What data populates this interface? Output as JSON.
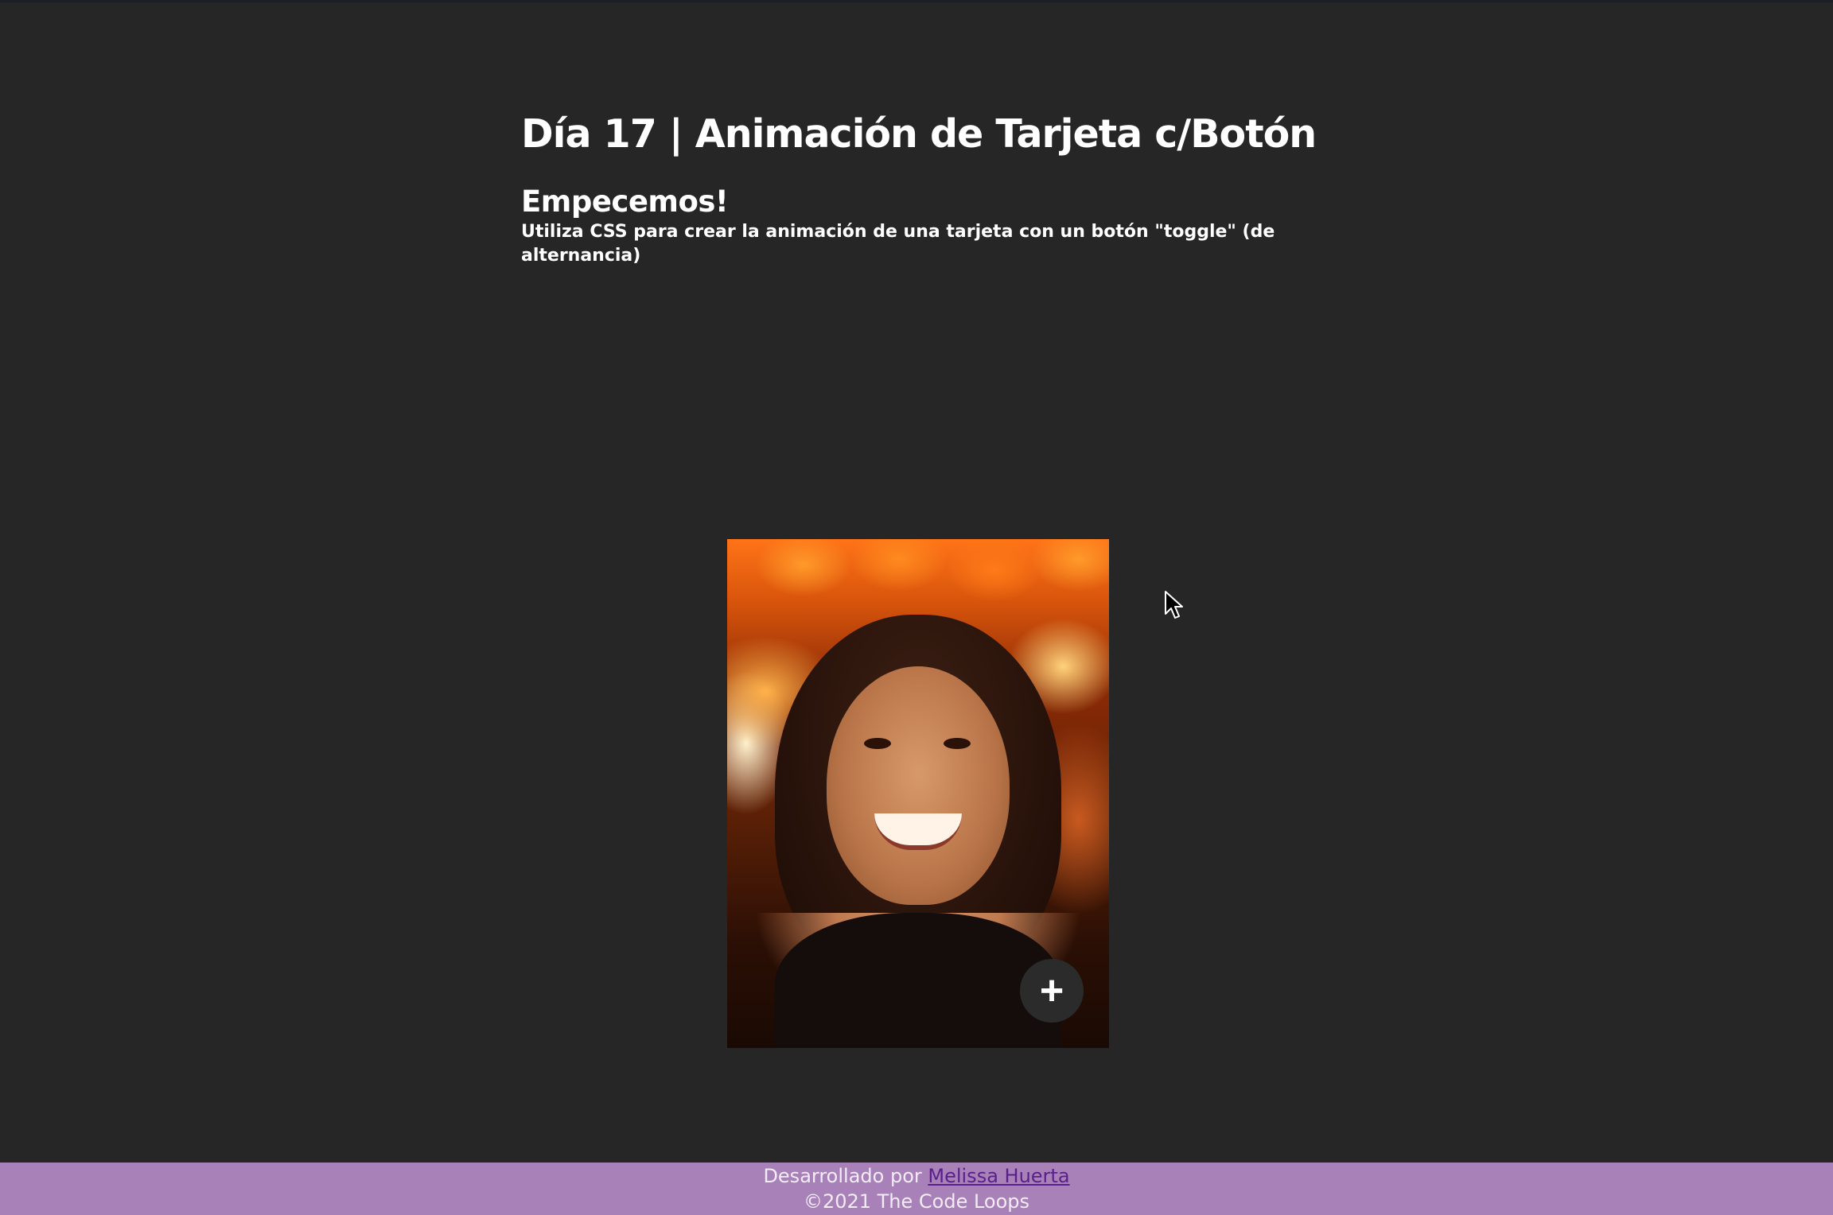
{
  "page": {
    "title": "Día 17 | Animación de Tarjeta c/Botón",
    "subtitle": "Empecemos!",
    "description": "Utiliza CSS para crear la animación de una tarjeta con un botón \"toggle\" (de alternancia)"
  },
  "card": {
    "photo_icon": "portrait-photo",
    "toggle_label": "+",
    "toggle_icon": "plus-icon"
  },
  "footer": {
    "developed_by_prefix": "Desarrollado por ",
    "author_link": "Melissa Huerta",
    "copyright": "©2021 The Code Loops"
  },
  "colors": {
    "background": "#262626",
    "footer_background": "#a781b8",
    "author_link": "#5a1f8a",
    "toggle_button": "#2b2b2b"
  }
}
